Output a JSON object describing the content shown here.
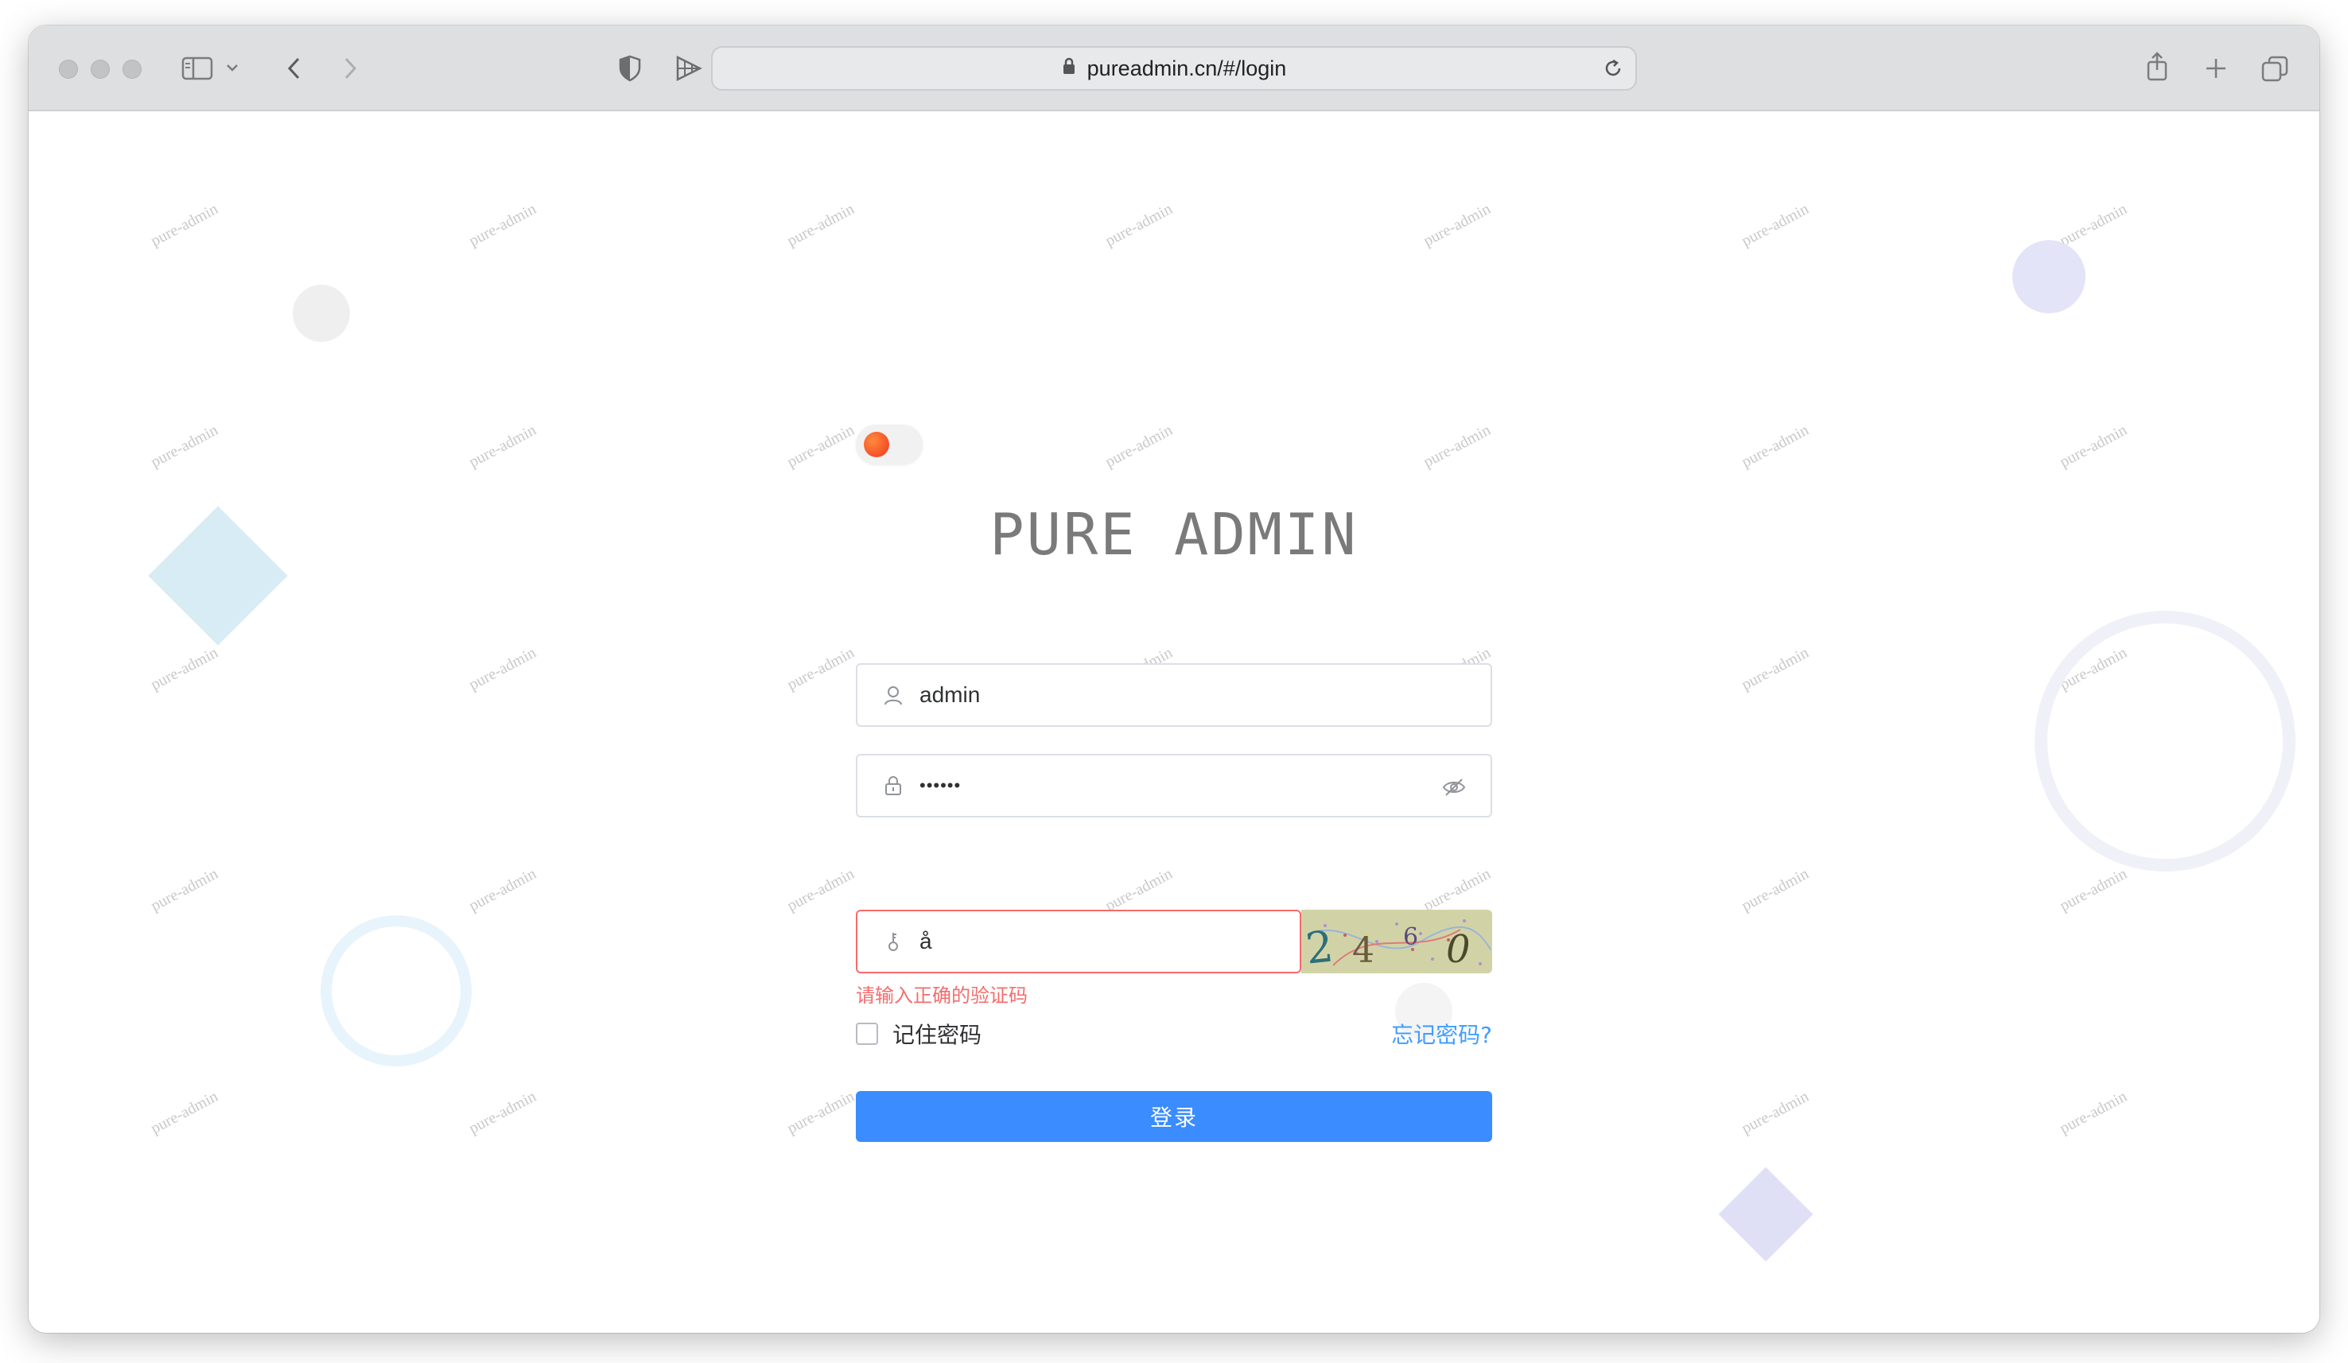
{
  "browser": {
    "url": "pureadmin.cn/#/login",
    "icons": {
      "sidebar": "sidebar-icon",
      "tabgroup_menu": "chevron-down-icon",
      "back": "chevron-left-icon",
      "forward": "chevron-right-icon",
      "privacy": "shield-icon",
      "extension": "extension-icon",
      "lock": "lock-icon",
      "reload": "reload-icon",
      "share": "share-icon",
      "new_tab": "plus-icon",
      "tab_overview": "tabs-icon"
    }
  },
  "watermark": {
    "text": "pure-admin"
  },
  "login": {
    "title": "PURE ADMIN",
    "username": {
      "value": "admin"
    },
    "password": {
      "masked_value": "••••••"
    },
    "captcha_input": {
      "value": "å"
    },
    "captcha_image_text": "2 4 6 0",
    "error_message": "请输入正确的验证码",
    "remember_label": "记住密码",
    "forgot_link": "忘记密码?",
    "submit_label": "登录"
  },
  "colors": {
    "primary": "#3a8cff",
    "link": "#409eff",
    "error": "#f56c6c",
    "title": "#7a7a7a",
    "toggle_knob": "#f2361f"
  }
}
